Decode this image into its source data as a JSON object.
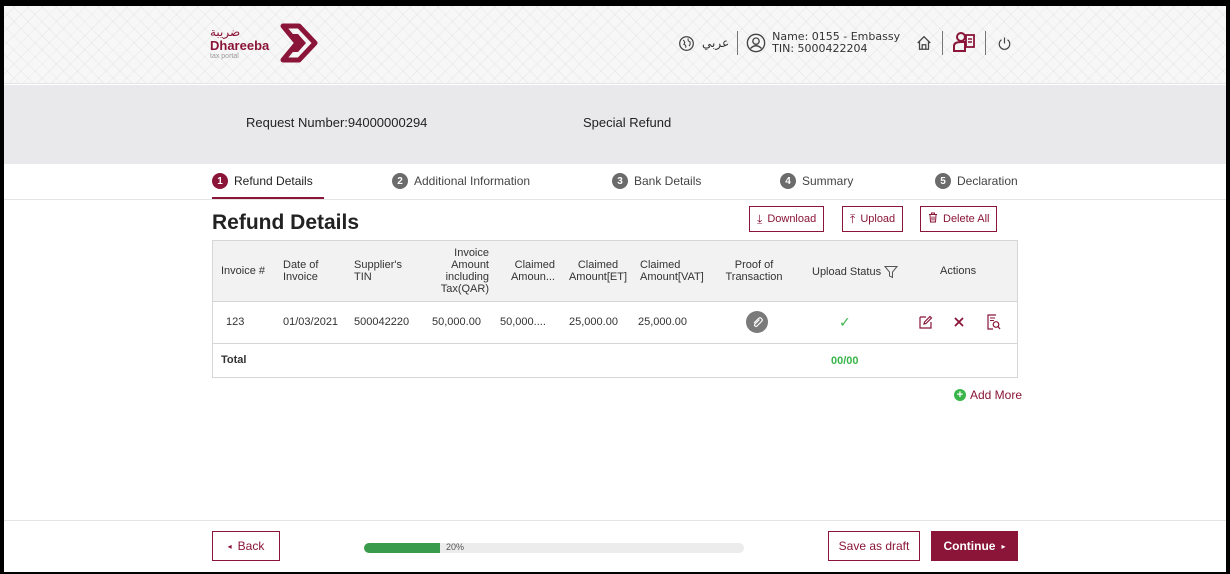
{
  "header": {
    "logo_arabic": "ضريبة",
    "logo_name": "Dhareeba",
    "logo_sub": "tax portal",
    "language_toggle": "عربي",
    "user_name_line": "Name: 0155 - Embassy",
    "user_tin_line": "TIN: 5000422204",
    "icons": [
      "globe-icon",
      "user-icon",
      "home-icon",
      "manual-icon",
      "power-icon"
    ]
  },
  "request": {
    "number": "Request Number:94000000294",
    "type": "Special Refund"
  },
  "stepper": {
    "steps": [
      {
        "num": "1",
        "label": "Refund Details",
        "active": true
      },
      {
        "num": "2",
        "label": "Additional Information",
        "active": false
      },
      {
        "num": "3",
        "label": "Bank Details",
        "active": false
      },
      {
        "num": "4",
        "label": "Summary",
        "active": false
      },
      {
        "num": "5",
        "label": "Declaration",
        "active": false
      }
    ]
  },
  "main": {
    "title": "Refund Details",
    "download_label": "Download",
    "upload_label": "Upload",
    "delete_all_label": "Delete All"
  },
  "table": {
    "headers": {
      "invoice_no": "Invoice #",
      "date_l1": "Date of",
      "date_l2": "Invoice",
      "tin_l1": "Supplier's",
      "tin_l2": "TIN",
      "amount_l1": "Invoice",
      "amount_l2": "Amount",
      "amount_l3": "including",
      "amount_l4": "Tax(QAR)",
      "claimed_l1": "Claimed",
      "claimed_l2": "Amoun...",
      "claimed_et_l1": "Claimed",
      "claimed_et_l2": "Amount[ET]",
      "claimed_vat_l1": "Claimed",
      "claimed_vat_l2": "Amount[VAT]",
      "proof_l1": "Proof of",
      "proof_l2": "Transaction",
      "upload_status": "Upload Status",
      "actions": "Actions"
    },
    "rows": [
      {
        "invoice_no": "123",
        "date": "01/03/2021",
        "supplier_tin": "500042220",
        "amount_incl_tax": "50,000.00",
        "claimed_amount": "50,000....",
        "claimed_et": "25,000.00",
        "claimed_vat": "25,000.00"
      }
    ],
    "total_label": "Total",
    "total_upload": "00/00"
  },
  "add_more_label": "Add More",
  "footer": {
    "back_label": "Back",
    "progress_label": "20%",
    "progress_value": 0.2,
    "save_draft_label": "Save as draft",
    "continue_label": "Continue"
  },
  "colors": {
    "brand": "#8a1538",
    "success": "#3ab54a",
    "progress": "#3a9b4c"
  }
}
